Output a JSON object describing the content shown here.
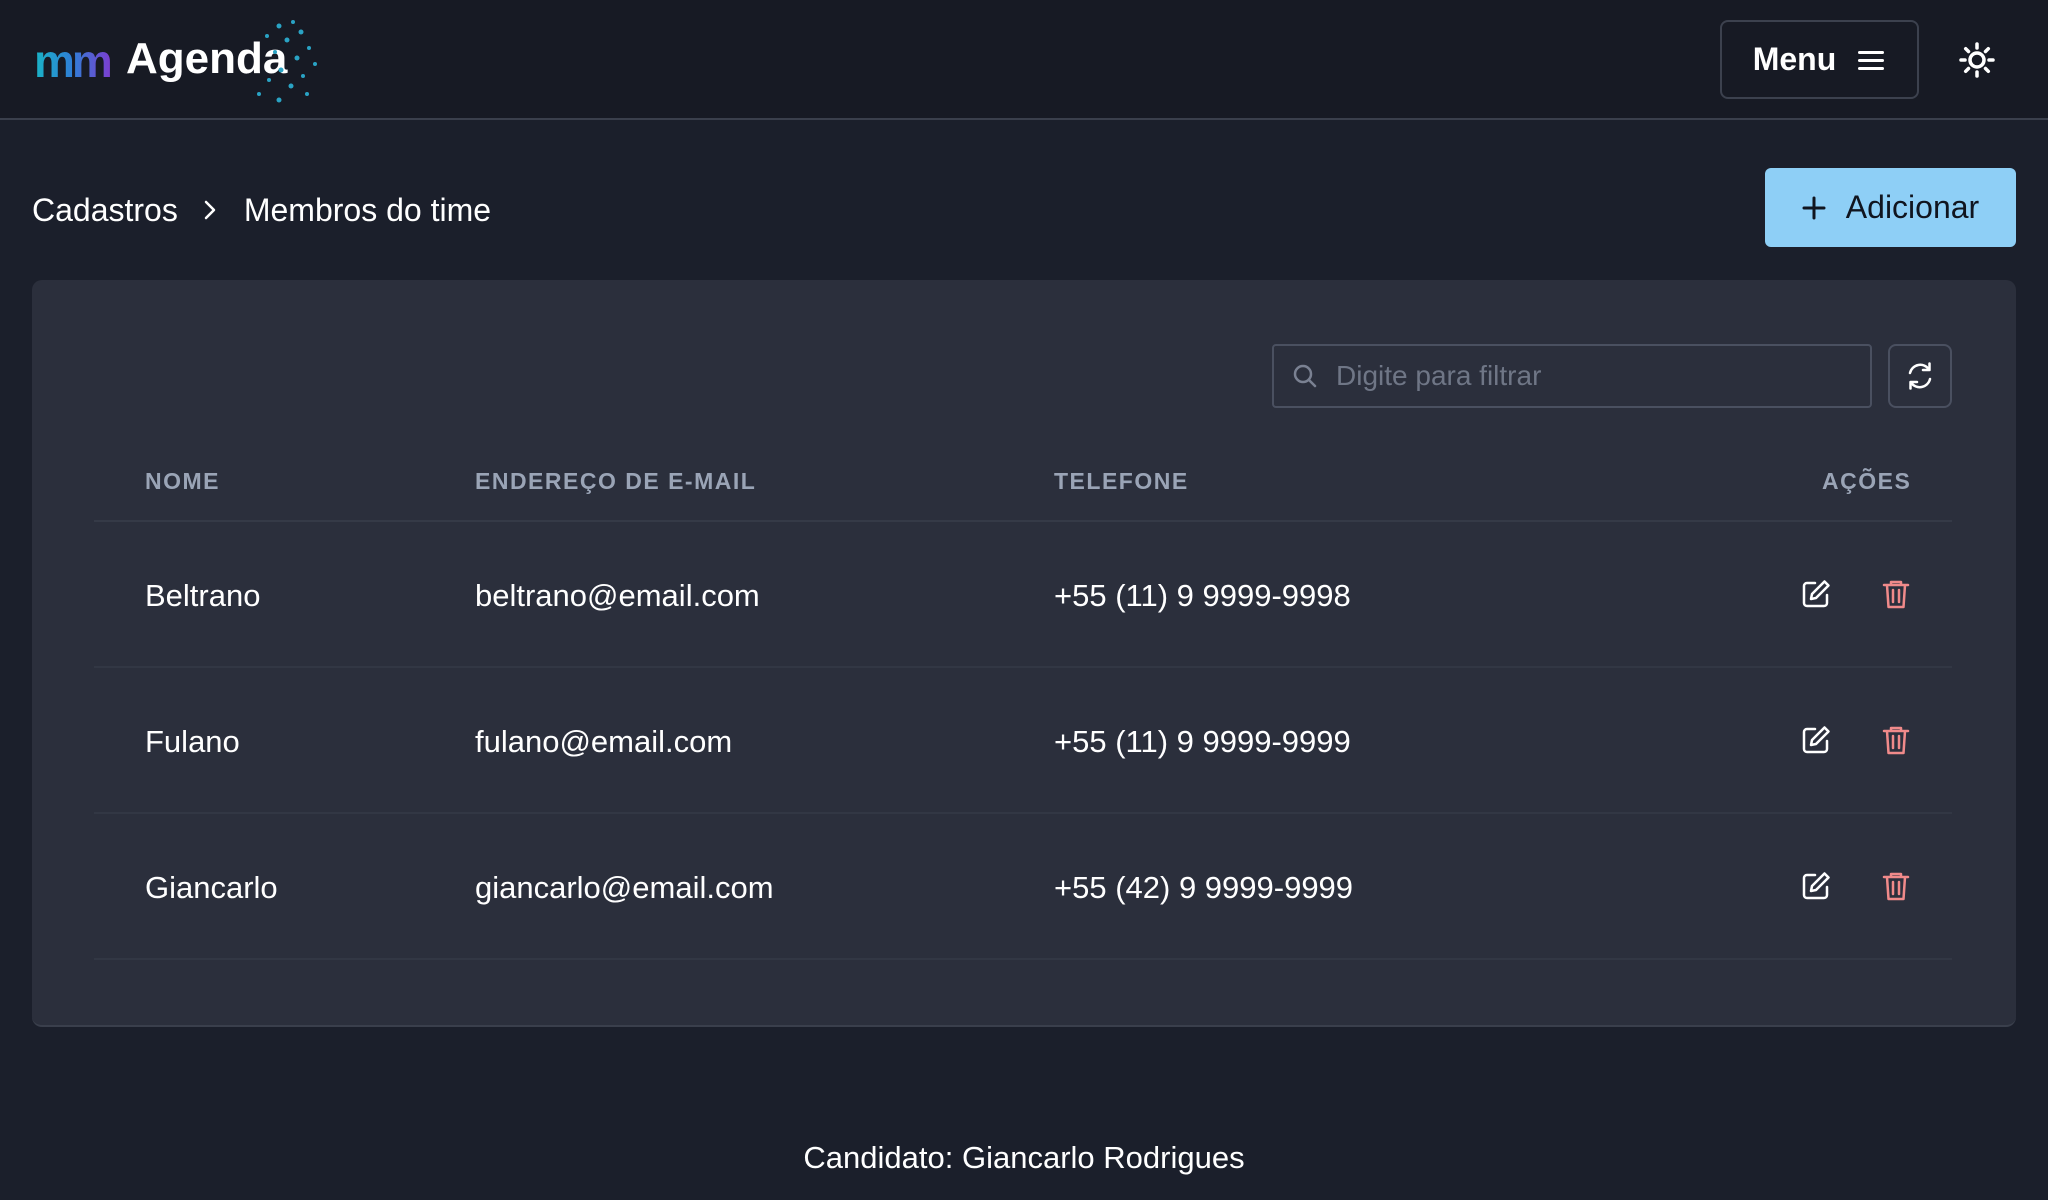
{
  "header": {
    "logo_mm": "mm",
    "logo_name": "Agenda",
    "menu_label": "Menu"
  },
  "breadcrumb": {
    "parent": "Cadastros",
    "current": "Membros do time"
  },
  "actions": {
    "add_label": "Adicionar"
  },
  "search": {
    "placeholder": "Digite para filtrar"
  },
  "table": {
    "columns": [
      "NOME",
      "ENDEREÇO DE E-MAIL",
      "TELEFONE",
      "AÇÕES"
    ],
    "rows": [
      {
        "name": "Beltrano",
        "email": "beltrano@email.com",
        "phone": "+55 (11) 9 9999-9998"
      },
      {
        "name": "Fulano",
        "email": "fulano@email.com",
        "phone": "+55 (11) 9 9999-9999"
      },
      {
        "name": "Giancarlo",
        "email": "giancarlo@email.com",
        "phone": "+55 (42) 9 9999-9999"
      }
    ]
  },
  "footer": {
    "text": "Candidato: Giancarlo Rodrigues"
  },
  "colors": {
    "background": "#1b1f2b",
    "header": "#171a24",
    "card": "#2b2f3c",
    "accent": "#8ecff6",
    "delete": "#f08a8a"
  },
  "icons": [
    "hamburger-icon",
    "sun-icon",
    "chevron-right-icon",
    "plus-icon",
    "search-icon",
    "refresh-icon",
    "edit-icon",
    "trash-icon"
  ]
}
